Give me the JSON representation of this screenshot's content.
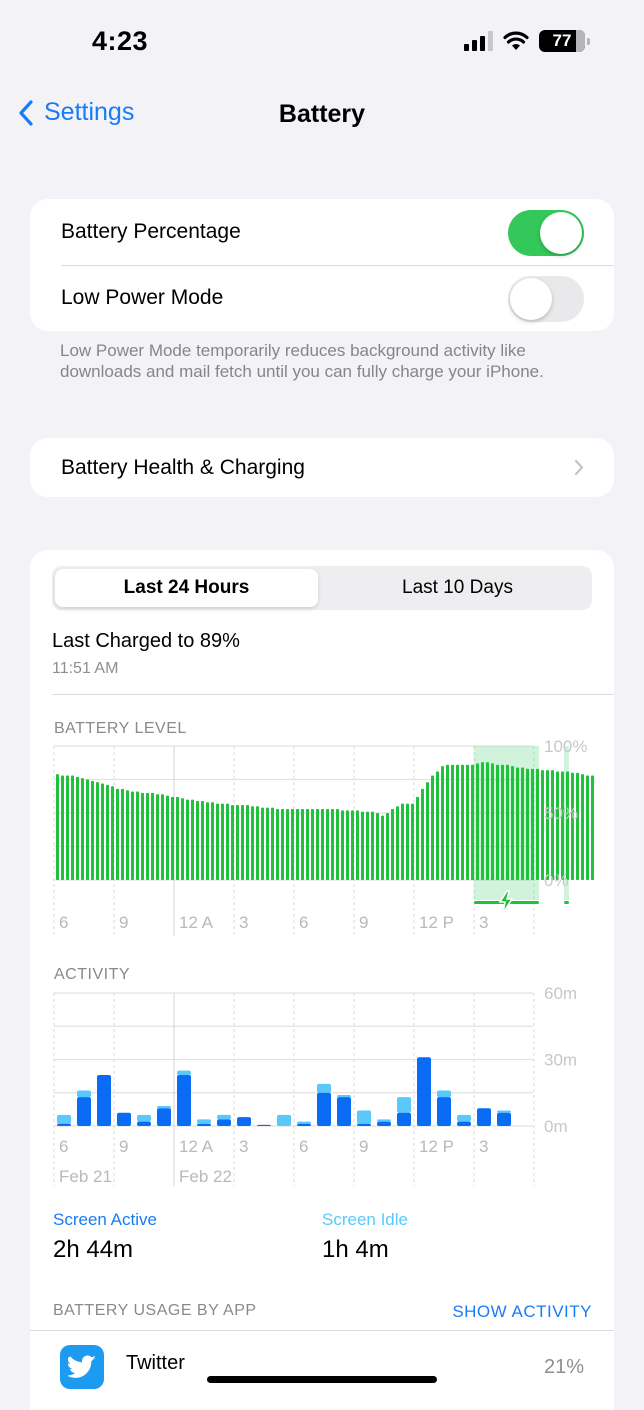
{
  "status_bar": {
    "time": "4:23",
    "battery_level": "77",
    "icons": [
      "cellular-signal-icon",
      "wifi-icon",
      "battery-icon"
    ]
  },
  "nav": {
    "back_label": "Settings",
    "title": "Battery"
  },
  "settings": {
    "battery_percentage": {
      "label": "Battery Percentage",
      "on": true
    },
    "low_power_mode": {
      "label": "Low Power Mode",
      "on": false
    },
    "footnote": "Low Power Mode temporarily reduces background activity like downloads and mail fetch until you can fully charge your iPhone."
  },
  "health": {
    "label": "Battery Health & Charging"
  },
  "usage": {
    "segments": [
      "Last 24 Hours",
      "Last 10 Days"
    ],
    "selected_segment": "Last 24 Hours",
    "last_charged": "Last Charged to 89%",
    "last_charged_time": "11:51 AM",
    "battery_level_label": "BATTERY LEVEL",
    "activity_label": "ACTIVITY",
    "screen_active_label": "Screen Active",
    "screen_active_value": "2h 44m",
    "screen_idle_label": "Screen Idle",
    "screen_idle_value": "1h 4m",
    "by_app_label": "BATTERY USAGE BY APP",
    "show_activity": "SHOW ACTIVITY",
    "apps": [
      {
        "name": "Twitter",
        "percent": "21%"
      }
    ]
  },
  "colors": {
    "accent": "#1a7cf5",
    "green": "#34c759",
    "battery_bar": "#1fc33b",
    "active": "#0a6cf5",
    "idle": "#5ac8fa"
  },
  "chart_data": [
    {
      "type": "bar",
      "title": "BATTERY LEVEL",
      "ylabel": "",
      "ylim": [
        0,
        100
      ],
      "yticks": [
        "100%",
        "50%",
        "0%"
      ],
      "xticks": [
        "6",
        "9",
        "12 A",
        "3",
        "6",
        "9",
        "12 P",
        "3"
      ],
      "interval": "15 minutes",
      "charging_windows": [
        [
          84,
          96
        ],
        [
          102,
          102
        ]
      ],
      "values": [
        79,
        78,
        78,
        78,
        77,
        76,
        75,
        74,
        73,
        72,
        71,
        70,
        68,
        68,
        67,
        66,
        66,
        65,
        65,
        65,
        64,
        64,
        63,
        62,
        62,
        61,
        60,
        60,
        59,
        59,
        58,
        58,
        57,
        57,
        57,
        56,
        56,
        56,
        56,
        55,
        55,
        54,
        54,
        54,
        53,
        53,
        53,
        53,
        53,
        53,
        53,
        53,
        53,
        53,
        53,
        53,
        53,
        52,
        52,
        52,
        52,
        51,
        51,
        51,
        50,
        48,
        50,
        53,
        55,
        57,
        57,
        57,
        62,
        68,
        73,
        78,
        81,
        85,
        86,
        86,
        86,
        86,
        86,
        86,
        87,
        88,
        88,
        87,
        86,
        86,
        86,
        85,
        84,
        84,
        83,
        83,
        83,
        82,
        82,
        82,
        81,
        81,
        81,
        80,
        80,
        79,
        78,
        78
      ],
      "grid": true
    },
    {
      "type": "bar",
      "stacked": true,
      "title": "ACTIVITY",
      "ylim": [
        0,
        60
      ],
      "yticks": [
        "60m",
        "30m",
        "0m"
      ],
      "xticks": [
        "6",
        "9",
        "12 A",
        "3",
        "6",
        "9",
        "12 P",
        "3"
      ],
      "date_labels": [
        "Feb 21",
        "Feb 22"
      ],
      "legend": [
        "Screen Active",
        "Screen Idle"
      ],
      "series": [
        {
          "name": "Screen Active",
          "values": [
            1,
            13,
            23,
            6,
            2,
            8,
            23,
            1,
            3,
            4,
            0.5,
            0,
            1,
            15,
            13,
            1,
            2,
            6,
            31,
            13,
            2,
            8,
            6
          ]
        },
        {
          "name": "Screen Idle",
          "values": [
            4,
            3,
            0,
            0,
            3,
            1,
            2,
            2,
            2,
            0,
            0,
            5,
            1,
            4,
            1,
            6,
            1,
            7,
            0,
            3,
            3,
            0,
            1
          ]
        }
      ],
      "grid": true
    }
  ]
}
